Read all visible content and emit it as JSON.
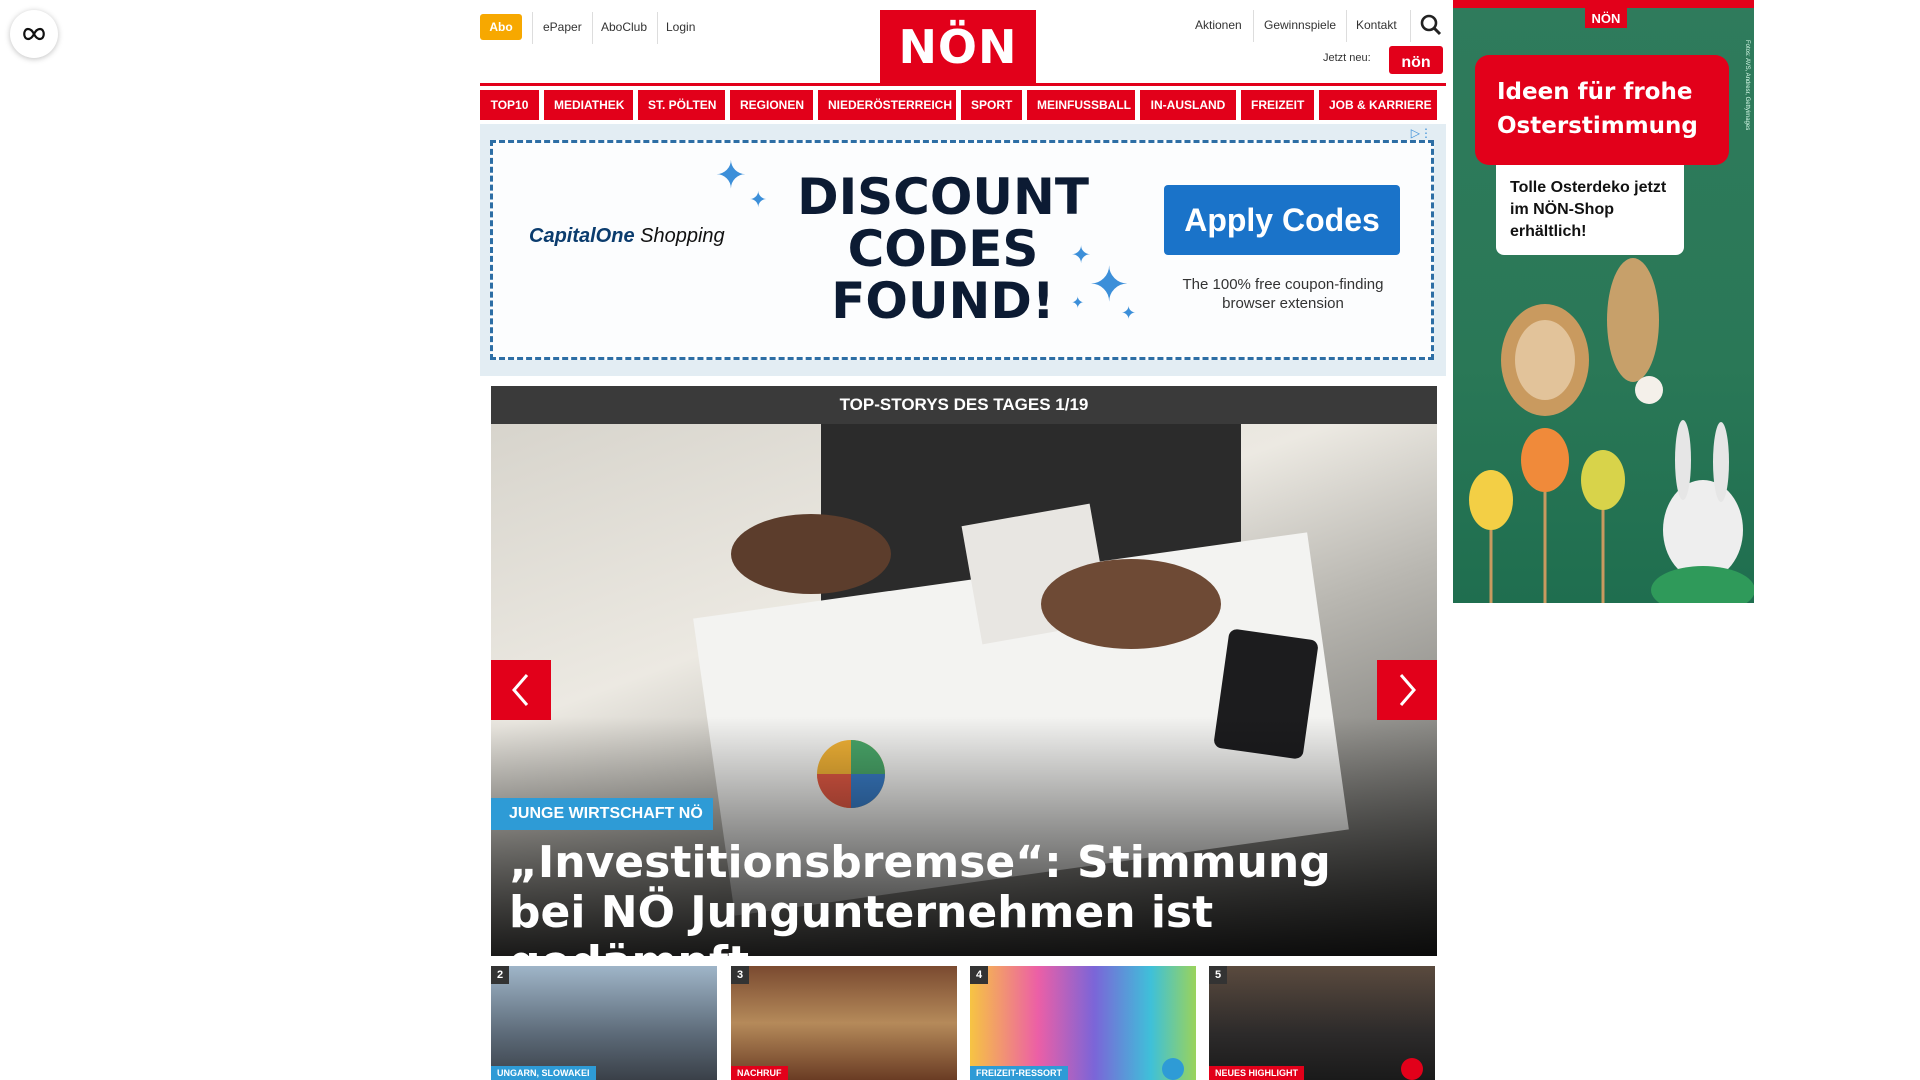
{
  "floating": {
    "icon": "infinity-icon"
  },
  "header": {
    "abo": "Abo",
    "links_left": [
      "ePaper",
      "AboClub",
      "Login"
    ],
    "logo": "NÖN",
    "links_right": [
      "Aktionen",
      "Gewinnspiele",
      "Kontakt"
    ],
    "search_icon": "search-icon",
    "jetzt_neu": "Jetzt neu:",
    "mini_logo": "nön"
  },
  "nav": {
    "items": [
      "TOP10",
      "MEDIATHEK",
      "ST. PÖLTEN",
      "REGIONEN",
      "NIEDERÖSTERREICH",
      "SPORT",
      "MEINFUSSBALL",
      "IN-AUSLAND",
      "FREIZEIT",
      "JOB & KARRIERE"
    ]
  },
  "ad": {
    "brand_capital": "CapitalOne",
    "brand_shopping": "Shopping",
    "headline": "DISCOUNT CODES FOUND!",
    "button": "Apply Codes",
    "sub": "The 100% free coupon-finding browser extension",
    "info_icon": "ad-choices-icon"
  },
  "slider": {
    "title": "TOP-STORYS DES TAGES 1/19",
    "category": "JUNGE WIRTSCHAFT NÖ",
    "headline": "„Investitionsbremse“: Stimmung bei NÖ Jungunternehmen ist gedämpft"
  },
  "thumbs": [
    {
      "num": "2",
      "tag": "UNGARN, SLOWAKEI",
      "tag_color": "#2e9bd6"
    },
    {
      "num": "3",
      "tag": "NACHRUF",
      "tag_color": "#e2001a"
    },
    {
      "num": "4",
      "tag": "FREIZEIT-RESSORT",
      "tag_color": "#2e9bd6",
      "icon": "camera-icon"
    },
    {
      "num": "5",
      "tag": "NEUES HIGHLIGHT",
      "tag_color": "#e2001a",
      "icon": "camera-icon"
    }
  ],
  "side_ad": {
    "logo": "NÖN",
    "bubble": "Ideen für frohe Osterstimmung",
    "sub": "Tolle Osterdeko jetzt im NÖN-Shop erhältlich!",
    "credit": "Fotos: AVS, Andresr, Gettyimages"
  },
  "colors": {
    "brand_red": "#e2001a",
    "accent_blue": "#2e9bd6",
    "abo_yellow": "#f7a800"
  }
}
